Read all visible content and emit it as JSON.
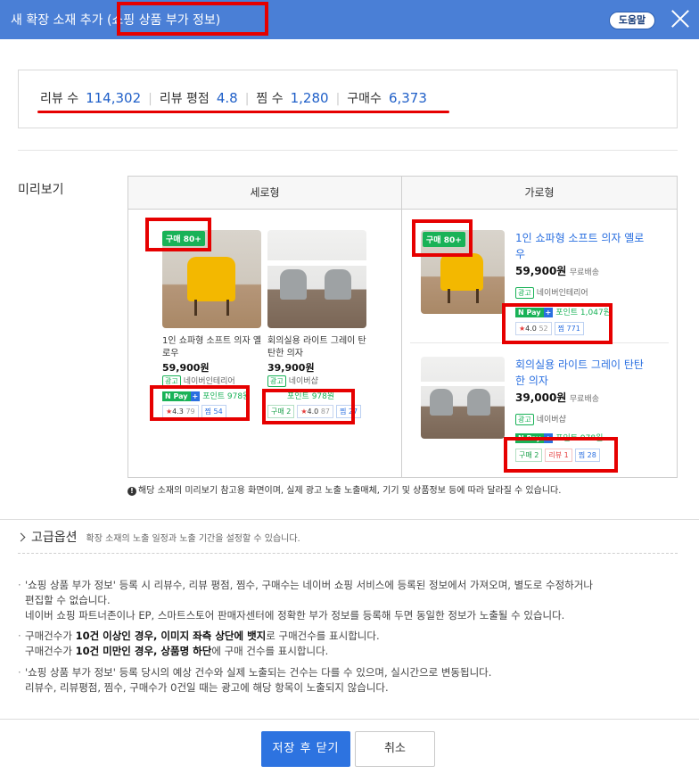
{
  "header": {
    "title": "새 확장 소재 추가 (쇼핑 상품 부가 정보)",
    "help_label": "도움말"
  },
  "stats": {
    "review_count_label": "리뷰 수",
    "review_count": "114,302",
    "review_rating_label": "리뷰 평점",
    "review_rating": "4.8",
    "wish_label": "찜 수",
    "wish_count": "1,280",
    "purchase_label": "구매수",
    "purchase_count": "6,373"
  },
  "preview": {
    "label": "미리보기",
    "vertical_header": "세로형",
    "horizontal_header": "가로형",
    "vertical": [
      {
        "badge": "구매 80+",
        "title_line1": "1인 쇼파형 소프트 의자 옐",
        "title_line2": "로우",
        "price": "59,900원",
        "ad": "광고",
        "seller": "네이버인테리어",
        "npay": "N Pay",
        "point": "포인트 978원",
        "rating": "4.3",
        "reviews": "79",
        "wish": "찜 54"
      },
      {
        "title_line1": "회의실용 라이트 그레이 탄",
        "title_line2": "탄한 의자",
        "price": "39,900원",
        "ad": "광고",
        "seller": "네이버샵",
        "point": "포인트 978원",
        "purchase_chip": "구매 2",
        "rating": "4.0",
        "reviews": "87",
        "wish": "찜 27"
      }
    ],
    "horizontal": [
      {
        "badge": "구매 80+",
        "title_line1": "1인 쇼파형 소프트 의자 옐로",
        "title_line2": "우",
        "price": "59,900원",
        "shipping": "무료배송",
        "ad": "광고",
        "seller": "네이버인테리어",
        "npay": "N Pay",
        "point": "포인트 1,047원",
        "rating": "4.0",
        "reviews": "52",
        "wish": "찜 771"
      },
      {
        "title_line1": "회의실용 라이트 그레이 탄탄",
        "title_line2": "한 의자",
        "price": "39,000원",
        "shipping": "무료배송",
        "ad": "광고",
        "seller": "네이버샵",
        "npay": "N Pay",
        "point": "포인트 978원",
        "purchase_chip": "구매 2",
        "review_chip": "리뷰 1",
        "wish": "찜 28"
      }
    ],
    "note": "해당 소재의 미리보기 참고용 화면이며, 실제 광고 노출 노출매체, 기기 및 상품정보 등에 따라 달라질 수 있습니다."
  },
  "advanced": {
    "label": "고급옵션",
    "desc": "확장 소재의 노출 일정과 노출 기간을 설정할 수 있습니다."
  },
  "info": {
    "p1_l1": "'쇼핑 상품 부가 정보' 등록 시 리뷰수, 리뷰 평점, 찜수, 구매수는 네이버 쇼핑 서비스에 등록된 정보에서 가져오며, 별도로 수정하거나",
    "p1_l2": "편집할 수 없습니다.",
    "p1_l3": "네이버 쇼핑 파트너존이나 EP, 스마트스토어 판매자센터에 정확한 부가 정보를 등록해 두면 동일한 정보가 노출될 수 있습니다.",
    "p2_l1_a": "구매건수가 ",
    "p2_l1_b": "10건 이상인 경우, 이미지 좌측 상단에 뱃지",
    "p2_l1_c": "로 구매건수를 표시합니다.",
    "p2_l2_a": "구매건수가 ",
    "p2_l2_b": "10건 미만인 경우, 상품명 하단",
    "p2_l2_c": "에 구매 건수를 표시합니다.",
    "p3_l1": "'쇼핑 상품 부가 정보' 등록 당시의 예상 건수와 실제 노출되는 건수는 다를 수 있으며, 실시간으로 변동됩니다.",
    "p3_l2": "리뷰수, 리뷰평점, 찜수, 구매수가 0건일 때는 광고에 해당 항목이 노출되지 않습니다."
  },
  "footer": {
    "save_label": "저장 후 닫기",
    "cancel_label": "취소"
  }
}
